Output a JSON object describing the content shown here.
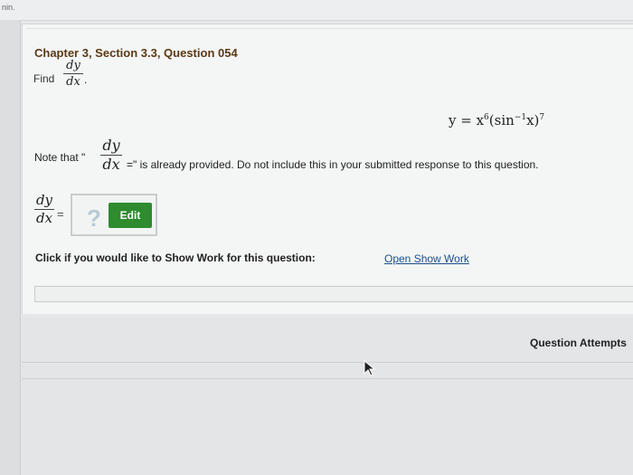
{
  "header": {
    "corner_text": "nin."
  },
  "question": {
    "title": "Chapter 3, Section 3.3, Question 054",
    "find_label": "Find",
    "find_numerator": "dy",
    "find_denominator": "dx",
    "find_period": ".",
    "equation": {
      "lhs": "y = x",
      "exp1": "6",
      "func": "(sin",
      "inv": "−1",
      "arg": "x)",
      "exp2": "7"
    },
    "note_prefix": "Note that \"",
    "note_numerator": "dy",
    "note_denominator": "dx",
    "note_suffix": "=\" is already provided. Do not include this in your submitted response to this question."
  },
  "answer": {
    "numerator": "dy",
    "denominator": "dx",
    "equals": "=",
    "placeholder_mark": "?",
    "edit_label": "Edit"
  },
  "show_work": {
    "prompt": "Click if you would like to Show Work for this question:",
    "link_label": "Open Show Work"
  },
  "attempts_label": "Question Attempts"
}
